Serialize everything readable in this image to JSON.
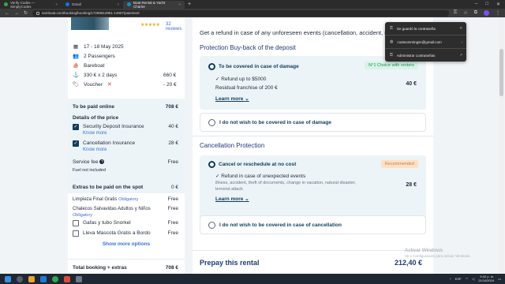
{
  "browser": {
    "tabs": [
      {
        "title": "Verify Codes — SimplyCodes",
        "active": false
      },
      {
        "title": "Gmail",
        "active": false
      },
      {
        "title": "Boat Rental & Yacht Charter",
        "active": true
      }
    ],
    "url": "samboat.com/booking/booking/17299612951-14907/paiement"
  },
  "password_popup": {
    "saved_label": "Se guardó la contraseña",
    "email": "custeommingss@gmail.com",
    "manage_label": "Administrar contraseñas"
  },
  "summary": {
    "reviews": "32 reviews",
    "stars": "★★★★★",
    "dates": "17 - 18 May 2025",
    "passengers": "2 Passengers",
    "boat_type": "Bareboat",
    "price_line": "330 € x 2 days",
    "price_amount": "660 €",
    "voucher_label": "Voucher",
    "voucher_amount": "- 20 €"
  },
  "to_pay": {
    "online_label": "To be paid online",
    "online_amount": "708 €",
    "details_label": "Details of the price",
    "security_label": "Security Deposit Insurance",
    "security_amount": "40 €",
    "cancel_label": "Cancellation Insurance",
    "cancel_amount": "28 €",
    "know_more": "Know more",
    "service_fee_label": "Service fee",
    "service_fee_amount": "Free",
    "fuel_label": "Fuel not included"
  },
  "extras": {
    "title": "Extras to be paid on the spot",
    "title_amount": "0 €",
    "items": [
      {
        "label": "Limpieza Final Gratis",
        "tag": "Obligatory",
        "amount": "Free"
      },
      {
        "label": "Chalecos Salvavidas Adultos y Niños",
        "tag": "Obligatory",
        "amount": "Free"
      },
      {
        "label": "Gafas y tubo Snorkel",
        "tag": "",
        "amount": "Free"
      },
      {
        "label": "Lleva Mascota Gratis a Bordo",
        "tag": "",
        "amount": "Free"
      }
    ],
    "show_more": "Show more options",
    "total_label": "Total booking + extras",
    "total_amount": "708 €"
  },
  "main": {
    "refund_text": "Get a refund in case of any unforeseen events (cancellation, accident, illness, etc.)",
    "protection_title": "Protection Buy-back of the deposit",
    "protection_option": {
      "title": "To be covered in case of damage",
      "badge": "N°1 Choice with renters",
      "line1": "✓ Refund up to $5000",
      "line2": "Residual franchise of 200 €",
      "learn_more": "Learn more",
      "price": "40 €"
    },
    "protection_decline": "I do not wish to be covered in case of damage",
    "cancellation_title": "Cancellation Protection",
    "cancellation_option": {
      "title": "Cancel or reschedule at no cost",
      "badge": "Recommended",
      "line1": "✓ Refund in case of unexpected events",
      "muted": "illness, accident, theft of documents, change in vacation, natural disaster, terrorist attack",
      "learn_more": "Learn more",
      "price": "28 €"
    },
    "cancellation_decline": "I do not wish to be covered in case of cancellation",
    "prepay_label": "Prepay this rental",
    "prepay_amount": "212,40 €"
  },
  "watermark": {
    "title": "Activar Windows",
    "subtitle": "Ve a Configuración para activar Windows."
  },
  "taskbar": {
    "time": "9:42 p. m.",
    "date": "21/10/2024",
    "lang": "ESP"
  }
}
